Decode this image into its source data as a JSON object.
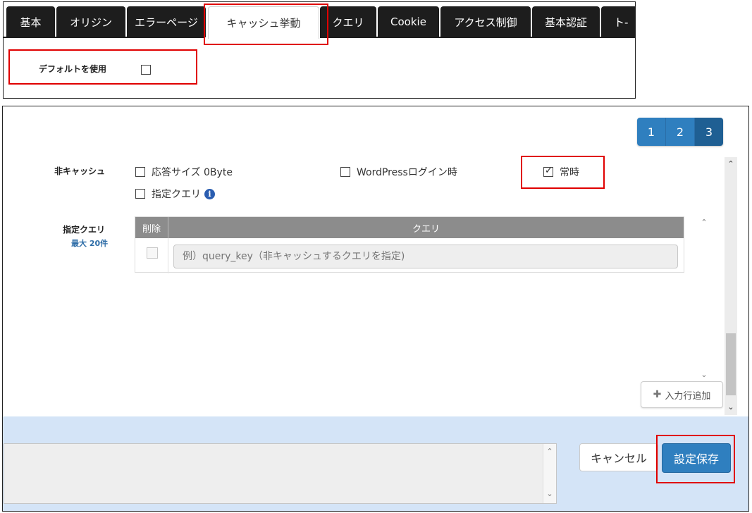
{
  "tabs": [
    {
      "label": "基本"
    },
    {
      "label": "オリジン"
    },
    {
      "label": "エラーページ"
    },
    {
      "label": "キャッシュ挙動",
      "active": true
    },
    {
      "label": "クエリ"
    },
    {
      "label": "Cookie"
    },
    {
      "label": "アクセス制御"
    },
    {
      "label": "基本認証"
    },
    {
      "label": "ト-"
    }
  ],
  "default_setting": {
    "label": "デフォルトを使用",
    "checked": false
  },
  "pagination": {
    "pages": [
      "1",
      "2",
      "3"
    ],
    "current": "3"
  },
  "non_cache": {
    "label": "非キャッシュ",
    "options": [
      {
        "label": "応答サイズ 0Byte",
        "checked": false
      },
      {
        "label": "WordPressログイン時",
        "checked": false
      },
      {
        "label": "常時",
        "checked": true
      },
      {
        "label": "指定クエリ",
        "checked": false,
        "info_icon": "info-icon"
      }
    ]
  },
  "specified_query": {
    "label": "指定クエリ",
    "max_label": "最大 20件",
    "columns": [
      "削除",
      "クエリ"
    ],
    "rows": [
      {
        "delete_checked": false,
        "value": "",
        "placeholder": "例）query_key（非キャッシュするクエリを指定)"
      }
    ]
  },
  "add_row_button": {
    "label": "入力行追加",
    "icon": "plus-icon"
  },
  "footer": {
    "cancel_label": "キャンセル",
    "save_label": "設定保存"
  },
  "colors": {
    "primary": "#2f7fbf",
    "tab_dark": "#1d1d1d",
    "highlight": "#e00000",
    "footer_bg": "#d4e4f7"
  }
}
